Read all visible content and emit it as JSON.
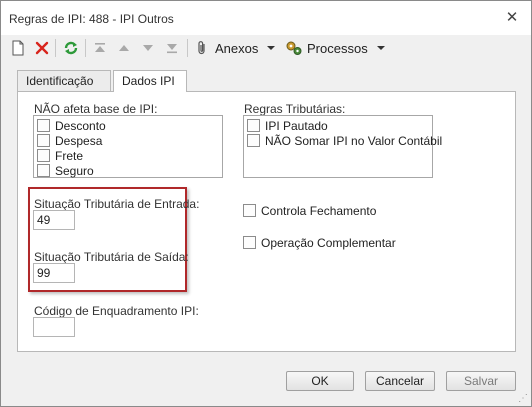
{
  "window": {
    "title": "Regras de IPI: 488 - IPI Outros",
    "close_glyph": "✕"
  },
  "toolbar": {
    "anexos_label": "Anexos",
    "processos_label": "Processos"
  },
  "tabs": [
    {
      "label": "Identificação"
    },
    {
      "label": "Dados IPI"
    }
  ],
  "panel": {
    "nao_afeta_label": "NÃO afeta base de IPI:",
    "nao_afeta_items": [
      "Desconto",
      "Despesa",
      "Frete",
      "Seguro"
    ],
    "regras_label": "Regras Tributárias:",
    "regras_items": [
      "IPI Pautado",
      "NÃO Somar IPI no Valor Contábil"
    ],
    "entrada_label": "Situação Tributária de Entrada:",
    "entrada_value": "49",
    "saida_label": "Situação Tributária de Saída:",
    "saida_value": "99",
    "enquadramento_label": "Código de Enquadramento IPI:",
    "enquadramento_value": "",
    "controla_fechamento_label": "Controla Fechamento",
    "operacao_complementar_label": "Operação Complementar"
  },
  "footer": {
    "ok_label": "OK",
    "cancel_label": "Cancelar",
    "save_label": "Salvar"
  },
  "colors": {
    "highlight": "#b0282a",
    "delete": "#d8241c",
    "refresh": "#2e9a3a"
  }
}
